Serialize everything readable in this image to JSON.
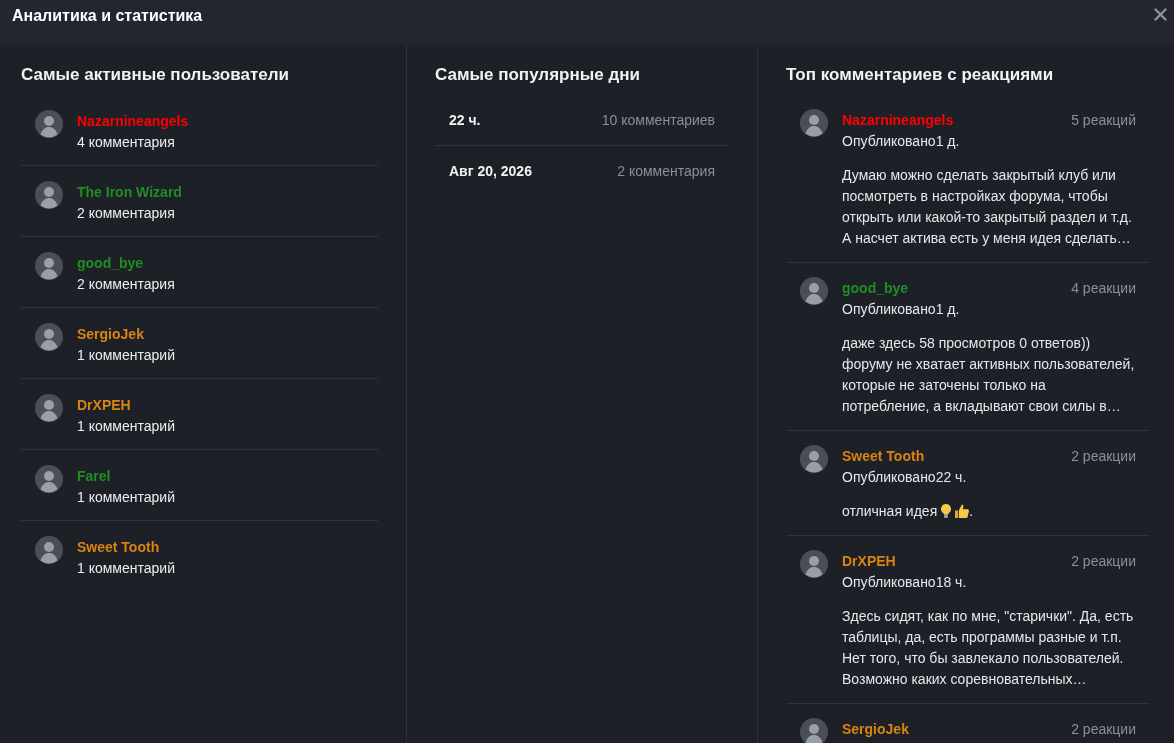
{
  "window": {
    "title": "Аналитика и статистика"
  },
  "active_users": {
    "title": "Самые активные пользователи",
    "items": [
      {
        "name": "Nazarnineangels",
        "color": "#ff0000",
        "comments": "4 комментария"
      },
      {
        "name": "The Iron Wizard",
        "color": "#1f8f1f",
        "comments": "2 комментария"
      },
      {
        "name": "good_bye",
        "color": "#1f8f1f",
        "comments": "2 комментария"
      },
      {
        "name": "SergioJek",
        "color": "#d98310",
        "comments": "1 комментарий"
      },
      {
        "name": "DrXPEH",
        "color": "#d98310",
        "comments": "1 комментарий"
      },
      {
        "name": "Farel",
        "color": "#1f8f1f",
        "comments": "1 комментарий"
      },
      {
        "name": "Sweet Tooth",
        "color": "#d98310",
        "comments": "1 комментарий"
      }
    ]
  },
  "popular_days": {
    "title": "Самые популярные дни",
    "rows": [
      {
        "day": "22 ч.",
        "comments": "10 комментариев"
      },
      {
        "day": "Авг 20, 2026",
        "comments": "2 комментария"
      }
    ]
  },
  "top_comments": {
    "title": "Топ комментариев с реакциями",
    "items": [
      {
        "author": "Nazarnineangels",
        "color": "#ff0000",
        "reactions": "5 реакций",
        "published": "Опубликовано1 д.",
        "body": [
          {
            "kind": "text",
            "text": "Думаю можно сделать закрытый клуб или посмотреть в настройках форума, чтобы открыть или какой-то закрытый раздел и т.д. А насчет актива есть у меня идея сделать…"
          }
        ]
      },
      {
        "author": "good_bye",
        "color": "#1f8f1f",
        "reactions": "4 реакции",
        "published": "Опубликовано1 д.",
        "body": [
          {
            "kind": "text",
            "text": "даже здесь 58 просмотров 0 ответов)) форуму не хватает активных пользователей, которые не заточены только на потребление, а вкладывают свои силы в…"
          }
        ]
      },
      {
        "author": "Sweet Tooth",
        "color": "#d98310",
        "reactions": "2 реакции",
        "published": "Опубликовано22 ч.",
        "body": [
          {
            "kind": "text",
            "text": "отличная идея"
          },
          {
            "kind": "lightbulb"
          },
          {
            "kind": "thumbs_up"
          },
          {
            "kind": "text",
            "text": "."
          }
        ]
      },
      {
        "author": "DrXPEH",
        "color": "#d98310",
        "reactions": "2 реакции",
        "published": "Опубликовано18 ч.",
        "body": [
          {
            "kind": "text",
            "text": "Здесь сидят, как по мне, \"старички\". Да, есть таблицы, да, есть программы разные и т.п. Нет того, что бы завлекало пользователей. Возможно каких соревновательных…"
          }
        ]
      },
      {
        "author": "SergioJek",
        "color": "#d98310",
        "reactions": "2 реакции"
      }
    ]
  }
}
